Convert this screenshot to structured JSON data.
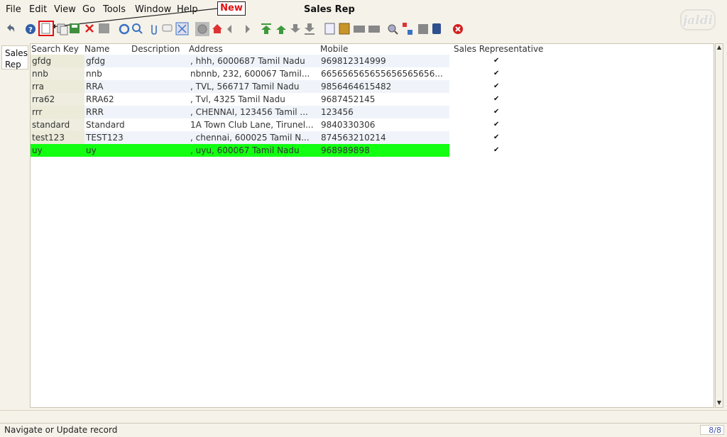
{
  "menu": [
    "File",
    "Edit",
    "View",
    "Go",
    "Tools",
    "Window",
    "Help"
  ],
  "window_title": "Sales Rep",
  "callout": "New",
  "logo": "jaldi",
  "side_tab": [
    "Sales",
    "Rep"
  ],
  "columns": [
    "Search Key",
    "Name",
    "Description",
    "Address",
    "Mobile",
    "Sales Representative"
  ],
  "rows": [
    {
      "search_key": "gfdg",
      "name": "gfdg",
      "description": "",
      "address": ", hhh,  6000687 Tamil Nadu",
      "mobile": "969812314999",
      "sales_rep": true
    },
    {
      "search_key": "nnb",
      "name": "nnb",
      "description": "",
      "address": "nbnnb, 232,  600067 Tamil...",
      "mobile": "665656565655656565656...",
      "sales_rep": true
    },
    {
      "search_key": "rra",
      "name": "RRA",
      "description": "",
      "address": ", TVL,  566717 Tamil Nadu",
      "mobile": "9856464615482",
      "sales_rep": true
    },
    {
      "search_key": "rra62",
      "name": "RRA62",
      "description": "",
      "address": ", Tvl,  4325 Tamil Nadu",
      "mobile": "9687452145",
      "sales_rep": true
    },
    {
      "search_key": "rrr",
      "name": "RRR",
      "description": "",
      "address": ", CHENNAI,  123456 Tamil ...",
      "mobile": "123456",
      "sales_rep": true
    },
    {
      "search_key": "standard",
      "name": "Standard",
      "description": "",
      "address": "1A Town Club Lane, Tirunel...",
      "mobile": "9840330306",
      "sales_rep": true
    },
    {
      "search_key": "test123",
      "name": "TEST123",
      "description": "",
      "address": ", chennai,  600025 Tamil N...",
      "mobile": "874563210214",
      "sales_rep": true
    },
    {
      "search_key": "uy",
      "name": "uy",
      "description": "",
      "address": ", uyu,  600067 Tamil Nadu",
      "mobile": "968989898",
      "sales_rep": true
    }
  ],
  "selected_row": 7,
  "status": {
    "text": "Navigate or Update record",
    "count": "8/8"
  },
  "colors": {
    "selection": "#12ff12",
    "callout_text": "#e01010",
    "background": "#f5f2e9"
  }
}
